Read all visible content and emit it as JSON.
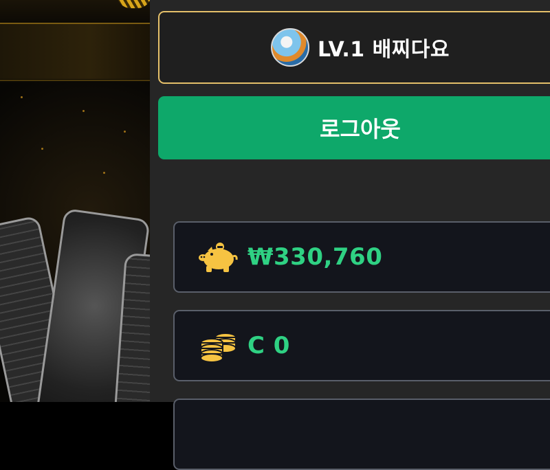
{
  "profile": {
    "name": "LV.1 배찌다요"
  },
  "logout": {
    "label": "로그아웃"
  },
  "wallet": {
    "money": "₩330,760",
    "coin": "C 0"
  },
  "colors": {
    "accent_green": "#0ea86a",
    "value_green": "#2fd183",
    "gold_border": "#e5c06a",
    "icon_gold": "#f6c342"
  },
  "icons": {
    "money": "piggy-bank-icon",
    "coin": "coin-stack-icon",
    "avatar": "character-avatar"
  }
}
